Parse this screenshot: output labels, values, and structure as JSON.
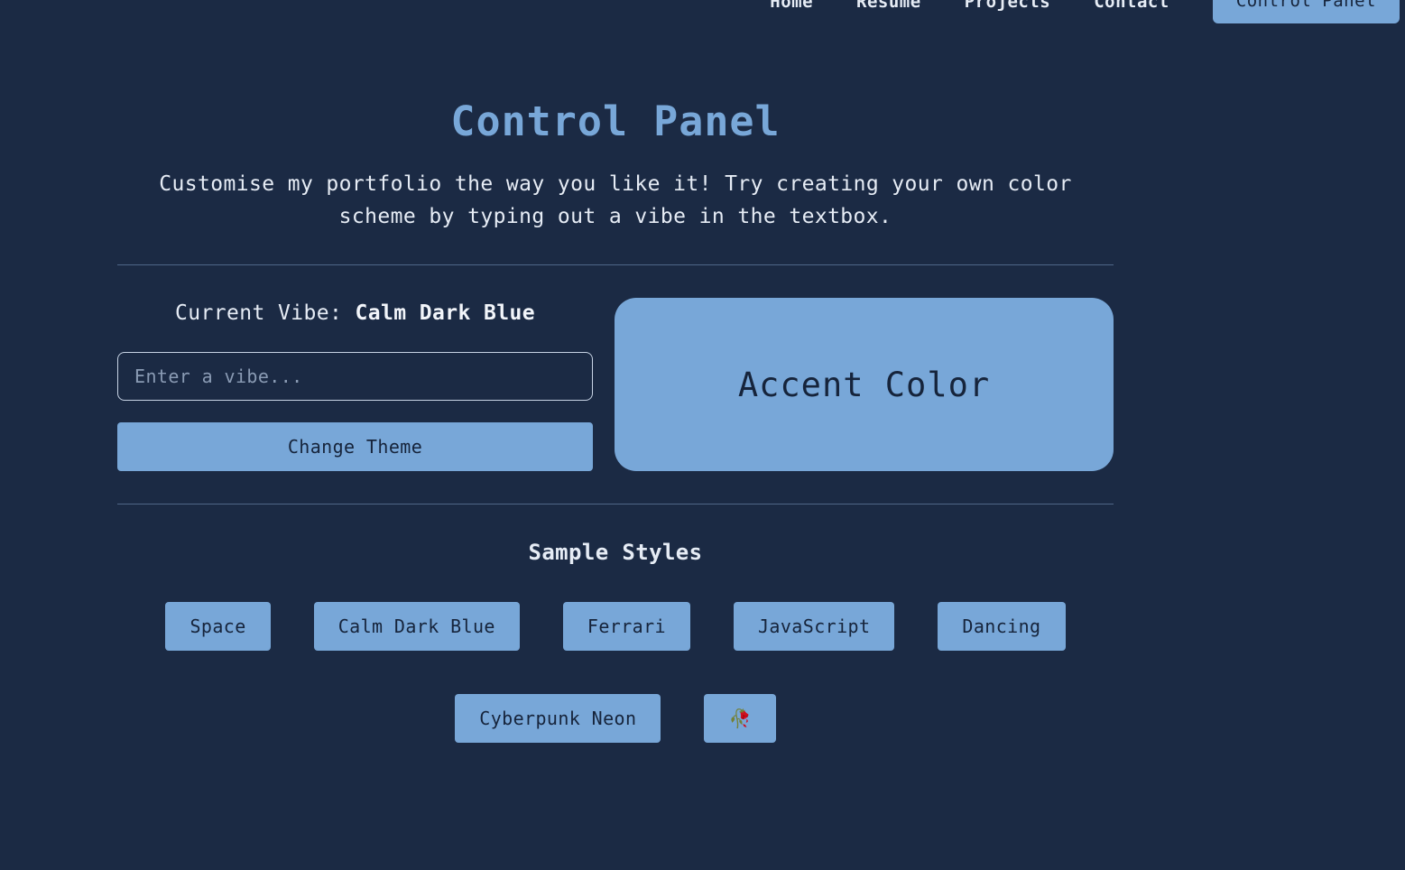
{
  "nav": {
    "items": [
      "Home",
      "Resume",
      "Projects",
      "Contact"
    ],
    "cta": "Control Panel"
  },
  "page": {
    "title": "Control Panel",
    "subtitle": "Customise my portfolio the way you like it! Try creating your own color scheme by typing out a vibe in the textbox."
  },
  "vibe": {
    "label": "Current Vibe:",
    "current": "Calm Dark Blue",
    "input_placeholder": "Enter a vibe...",
    "input_value": "",
    "change_button": "Change Theme"
  },
  "accent": {
    "label": "Accent Color",
    "color": "#78a7d8"
  },
  "samples": {
    "title": "Sample Styles",
    "row1": [
      "Space",
      "Calm Dark Blue",
      "Ferrari",
      "JavaScript",
      "Dancing"
    ],
    "row2": [
      "Cyberpunk Neon",
      "🥀"
    ]
  },
  "colors": {
    "background": "#1b2a44",
    "accent": "#78a7d8",
    "text": "#e6ecf5",
    "button_text": "#16243b"
  }
}
